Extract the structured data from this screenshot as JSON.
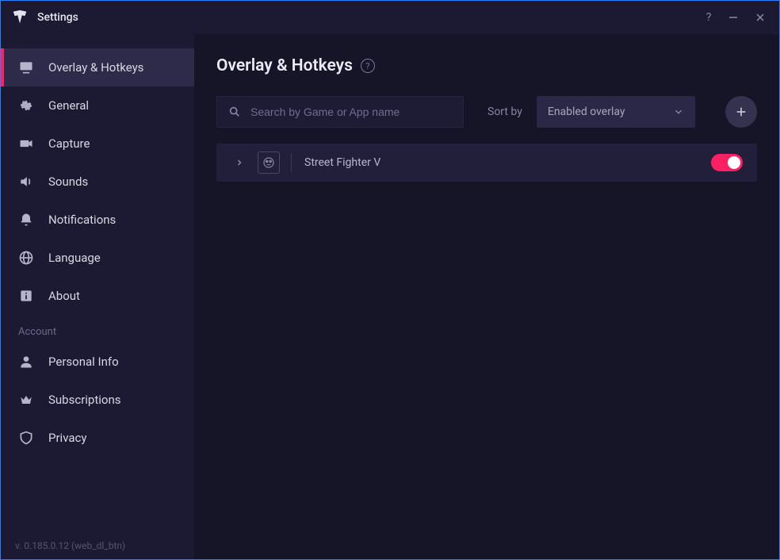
{
  "window": {
    "title": "Settings"
  },
  "sidebar": {
    "items": [
      {
        "label": "Overlay & Hotkeys",
        "icon": "monitor-icon",
        "active": true
      },
      {
        "label": "General",
        "icon": "gear-icon"
      },
      {
        "label": "Capture",
        "icon": "camera-icon"
      },
      {
        "label": "Sounds",
        "icon": "speaker-icon"
      },
      {
        "label": "Notifications",
        "icon": "bell-icon"
      },
      {
        "label": "Language",
        "icon": "globe-icon"
      },
      {
        "label": "About",
        "icon": "info-icon"
      }
    ],
    "account_label": "Account",
    "account_items": [
      {
        "label": "Personal Info",
        "icon": "person-icon"
      },
      {
        "label": "Subscriptions",
        "icon": "crown-icon"
      },
      {
        "label": "Privacy",
        "icon": "shield-icon"
      }
    ],
    "version": "v. 0.185.0.12 (web_dl_btn)"
  },
  "main": {
    "title": "Overlay & Hotkeys",
    "search_placeholder": "Search by Game or App name",
    "sort_label": "Sort by",
    "sort_value": "Enabled overlay",
    "games": [
      {
        "name": "Street Fighter V",
        "enabled": true
      }
    ]
  }
}
